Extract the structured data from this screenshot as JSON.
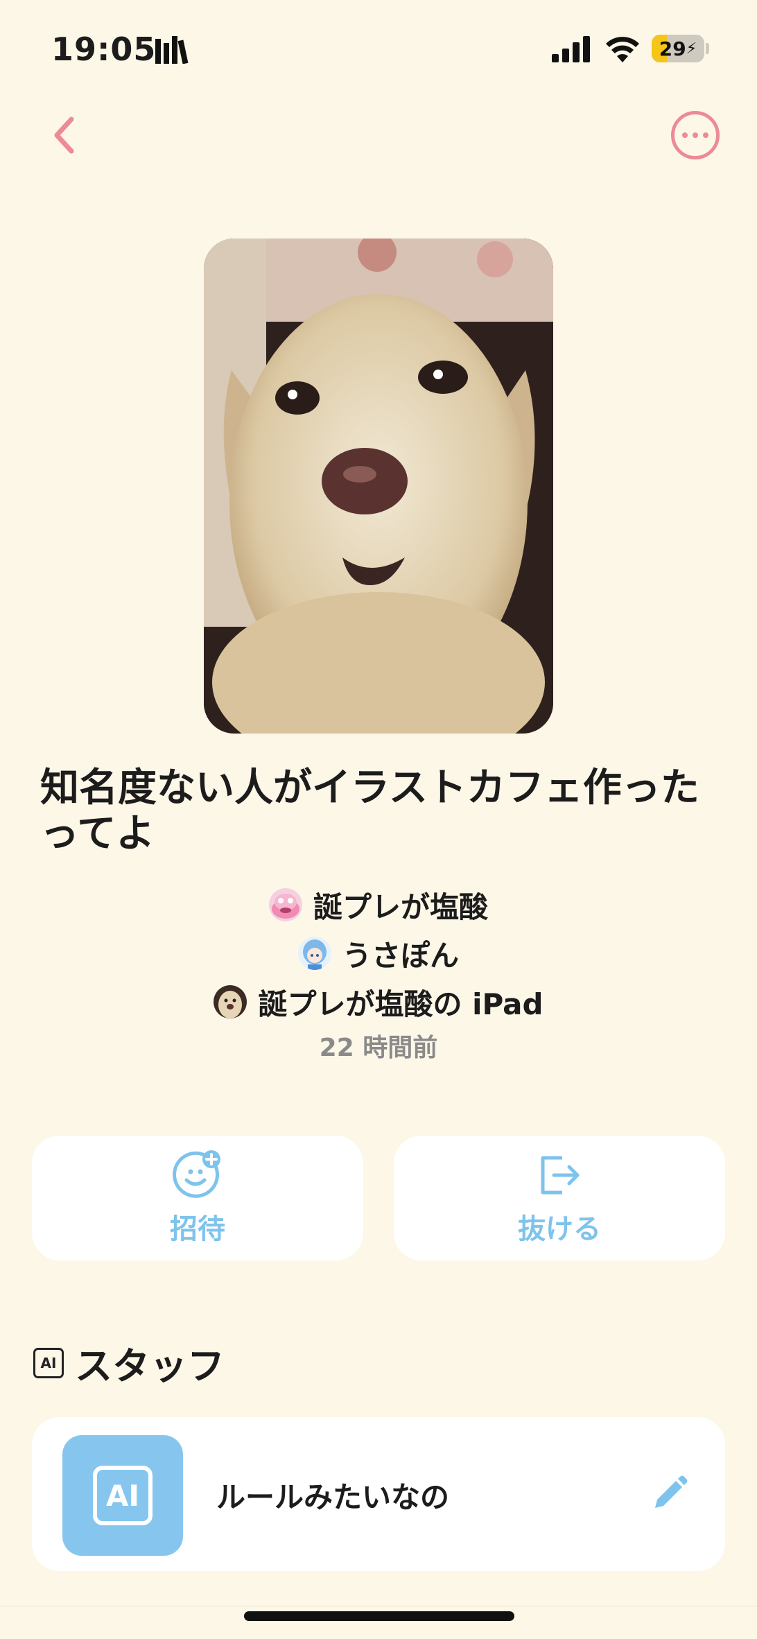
{
  "status_bar": {
    "time": "19:05",
    "battery": "29",
    "battery_level": 0.29
  },
  "header": {
    "back_icon": "chevron-left-icon",
    "more_icon": "ellipsis-circle-icon"
  },
  "group": {
    "title": "知名度ない人がイラストカフェ作ったってよ",
    "members": [
      {
        "name": "誕プレが塩酸",
        "avatar": "pink-creature-avatar"
      },
      {
        "name": "うさぽん",
        "avatar": "blue-hair-character-avatar"
      },
      {
        "name": "誕プレが塩酸の iPad",
        "avatar": "dog-avatar"
      }
    ],
    "updated": "22 時間前"
  },
  "actions": {
    "invite_label": "招待",
    "leave_label": "抜ける",
    "invite_icon": "add-friend-icon",
    "leave_icon": "exit-icon"
  },
  "staff_section": {
    "title": "スタッフ",
    "badge": "AI",
    "items": [
      {
        "name": "ルールみたいなの",
        "badge": "AI",
        "edit_icon": "pencil-icon"
      }
    ]
  },
  "colors": {
    "background": "#fdf7e8",
    "accent_pink": "#ec8a96",
    "accent_blue": "#7ec3ec",
    "staff_avatar_bg": "#86c6ee"
  }
}
